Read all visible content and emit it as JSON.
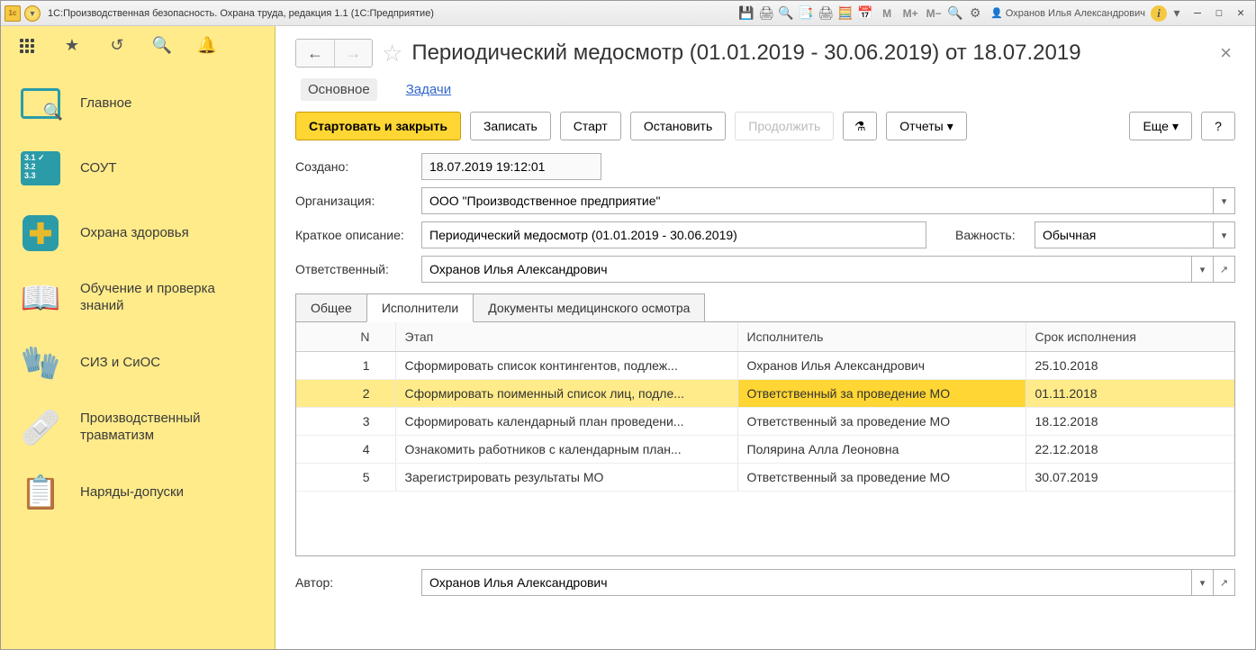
{
  "titlebar": {
    "app_title": "1С:Производственная безопасность. Охрана труда, редакция 1.1  (1С:Предприятие)",
    "user": "Охранов Илья Александрович"
  },
  "sidebar": {
    "items": [
      {
        "label": "Главное"
      },
      {
        "label": "СОУТ"
      },
      {
        "label": "Охрана здоровья"
      },
      {
        "label": "Обучение и проверка знаний"
      },
      {
        "label": "СИЗ и СиОС"
      },
      {
        "label": "Производственный травматизм"
      },
      {
        "label": "Наряды-допуски"
      }
    ]
  },
  "page": {
    "title": "Периодический медосмотр (01.01.2019 - 30.06.2019)  от 18.07.2019",
    "tabs": {
      "main": "Основное",
      "tasks": "Задачи"
    }
  },
  "toolbar": {
    "start_close": "Стартовать и закрыть",
    "write": "Записать",
    "start": "Старт",
    "stop": "Остановить",
    "continue": "Продолжить",
    "reports": "Отчеты",
    "more": "Еще",
    "help": "?"
  },
  "form": {
    "created_label": "Создано:",
    "created_value": "18.07.2019 19:12:01",
    "org_label": "Организация:",
    "org_value": "ООО \"Производственное предприятие\"",
    "desc_label": "Краткое описание:",
    "desc_value": "Периодический медосмотр (01.01.2019 - 30.06.2019)",
    "importance_label": "Важность:",
    "importance_value": "Обычная",
    "resp_label": "Ответственный:",
    "resp_value": "Охранов Илья Александрович",
    "author_label": "Автор:",
    "author_value": "Охранов Илья Александрович"
  },
  "inner_tabs": {
    "general": "Общее",
    "performers": "Исполнители",
    "docs": "Документы медицинского осмотра"
  },
  "table": {
    "headers": {
      "n": "N",
      "stage": "Этап",
      "executor": "Исполнитель",
      "due": "Срок исполнения"
    },
    "rows": [
      {
        "n": "1",
        "stage": "Сформировать список контингентов, подлеж...",
        "executor": "Охранов Илья Александрович",
        "due": "25.10.2018",
        "sel": false
      },
      {
        "n": "2",
        "stage": "Сформировать поименный список лиц, подле...",
        "executor": "Ответственный за проведение МО",
        "due": "01.11.2018",
        "sel": true
      },
      {
        "n": "3",
        "stage": "Сформировать календарный план проведени...",
        "executor": "Ответственный за проведение МО",
        "due": "18.12.2018",
        "sel": false
      },
      {
        "n": "4",
        "stage": "Ознакомить работников с календарным план...",
        "executor": "Полярина Алла Леоновна",
        "due": "22.12.2018",
        "sel": false
      },
      {
        "n": "5",
        "stage": "Зарегистрировать результаты МО",
        "executor": "Ответственный за проведение МО",
        "due": "30.07.2019",
        "sel": false
      }
    ]
  }
}
